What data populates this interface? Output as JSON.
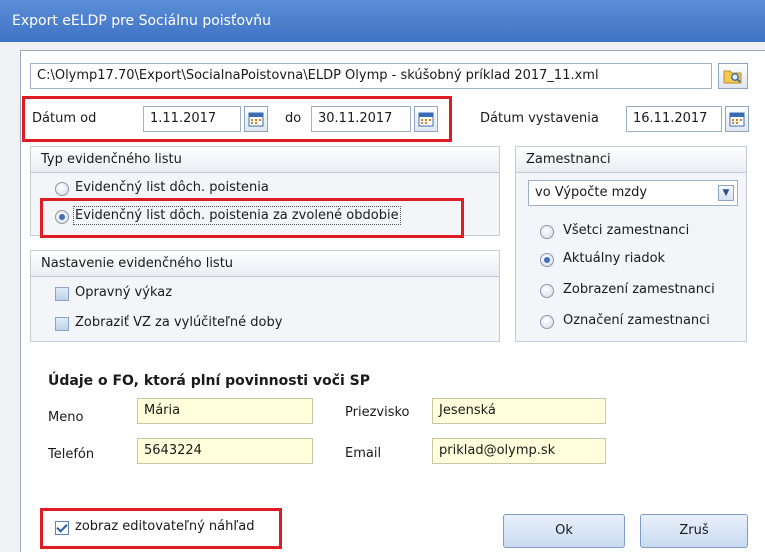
{
  "window": {
    "title": "Export eELDP pre Sociálnu poisťovňu"
  },
  "file": {
    "path": "C:\\Olymp17.70\\Export\\SocialnaPoistovna\\ELDP Olymp - skúšobný príklad 2017_11.xml"
  },
  "dates": {
    "from_label": "Dátum od",
    "from_value": "1.11.2017",
    "to_label": "do",
    "to_value": "30.11.2017",
    "issue_label": "Dátum vystavenia",
    "issue_value": "16.11.2017"
  },
  "list_type": {
    "title": "Typ evidenčného listu",
    "options": [
      "Evidenčný list dôch. poistenia",
      "Evidenčný list dôch. poistenia za zvolené obdobie"
    ],
    "selected_index": 1
  },
  "list_settings": {
    "title": "Nastavenie evidenčného listu",
    "options": [
      "Opravný výkaz",
      "Zobraziť VZ za vylúčiteľné doby"
    ]
  },
  "employees": {
    "title": "Zamestnanci",
    "source_value": "vo Výpočte mzdy",
    "options": [
      "Všetci zamestnanci",
      "Aktuálny riadok",
      "Zobrazení zamestnanci",
      "Označení zamestnanci"
    ],
    "selected_index": 1
  },
  "person": {
    "heading": "Údaje o FO, ktorá plní povinnosti voči SP",
    "name_label": "Meno",
    "name_value": "Mária",
    "surname_label": "Priezvisko",
    "surname_value": "Jesenská",
    "phone_label": "Telefón",
    "phone_value": "5643224",
    "email_label": "Email",
    "email_value": "priklad@olymp.sk"
  },
  "footer": {
    "preview_label": "zobraz editovateľný náhľad",
    "preview_checked": true,
    "ok_label": "Ok",
    "cancel_label": "Zruš"
  },
  "icons": {
    "browse": "folder-search-icon",
    "calendar": "calendar-icon",
    "dropdown": "chevron-down-icon"
  },
  "colors": {
    "highlight": "#e01b24",
    "title_bar": "#4a7fcf",
    "input_yellow": "#ffffdc"
  }
}
